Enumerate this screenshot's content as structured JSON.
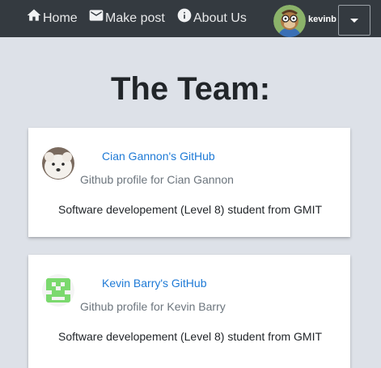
{
  "nav": {
    "home": {
      "label": "Home",
      "icon": "home-icon"
    },
    "make_post": {
      "label": "Make post",
      "icon": "mail-icon"
    },
    "about": {
      "label": "About Us",
      "icon": "info-icon"
    },
    "user": {
      "name": "kevinb"
    },
    "colors": {
      "bar": "#343a40",
      "text": "#e8e9ea"
    }
  },
  "main": {
    "title": "The Team:",
    "members": [
      {
        "link": "Cian Gannon's GitHub",
        "subtitle": "Github profile for Cian Gannon",
        "description": "Software developement (Level 8) student from GMIT"
      },
      {
        "link": "Kevin Barry's GitHub",
        "subtitle": "Github profile for Kevin Barry",
        "description": "Software developement (Level 8) student from GMIT"
      }
    ]
  },
  "colors": {
    "background": "#dde1e8",
    "link": "#1e7ad6",
    "muted": "#6c757d"
  }
}
